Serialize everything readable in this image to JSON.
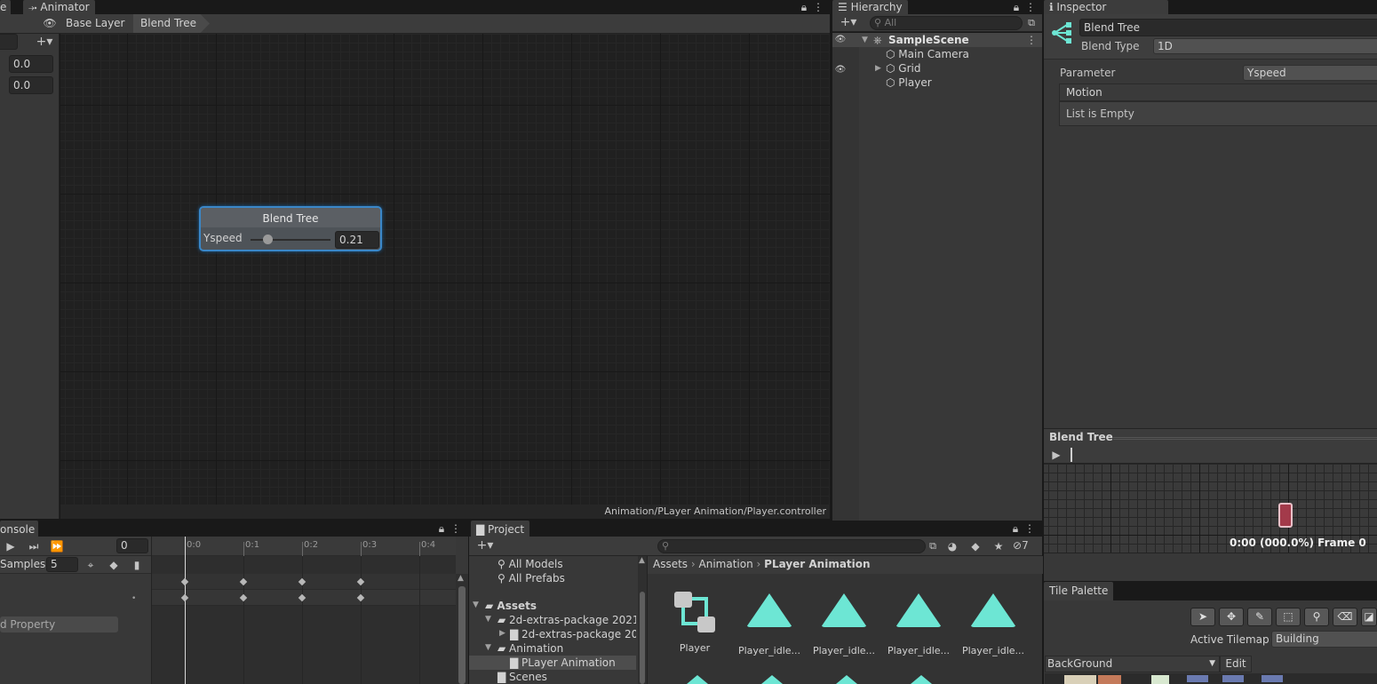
{
  "animator": {
    "tab_label": "Animator",
    "breadcrumb": [
      "Base Layer",
      "Blend Tree"
    ],
    "param_values": [
      "0.0",
      "0.0"
    ],
    "node": {
      "title": "Blend Tree",
      "param": "Yspeed",
      "value": "0.21",
      "slider_fraction": 0.21
    },
    "footer_path": "Animation/PLayer Animation/Player.controller"
  },
  "hierarchy": {
    "tab_label": "Hierarchy",
    "search_placeholder": "All",
    "scene": "SampleScene",
    "items": [
      "Main Camera",
      "Grid",
      "Player"
    ]
  },
  "inspector": {
    "tab_label": "Inspector",
    "object_name": "Blend Tree",
    "blend_type_label": "Blend Type",
    "blend_type_value": "1D",
    "parameter_label": "Parameter",
    "parameter_value": "Yspeed",
    "motion_label": "Motion",
    "list_empty": "List is Empty",
    "preview_title": "Blend Tree",
    "preview_time": "0:00 (000.0%) Frame 0"
  },
  "console": {
    "tab_label": "onsole",
    "frame_value": "0",
    "samples_label": "Samples",
    "samples_value": "5",
    "ticks": [
      "0:0",
      "0:1",
      "0:2",
      "0:3",
      "0:4"
    ],
    "add_property": "d Property"
  },
  "project": {
    "tab_label": "Project",
    "hidden_count": "7",
    "tree": [
      "All Models",
      "All Prefabs",
      "Assets",
      "2d-extras-package 2021",
      "2d-extras-package 20",
      "Animation",
      "PLayer Animation",
      "Scenes"
    ],
    "breadcrumb": [
      "Assets",
      "Animation",
      "PLayer Animation"
    ],
    "assets": [
      "Player",
      "Player_idle...",
      "Player_idle...",
      "Player_idle...",
      "Player_idle..."
    ]
  },
  "tile_palette": {
    "tab_label": "Tile Palette",
    "active_tilemap_label": "Active Tilemap",
    "active_tilemap_value": "Building",
    "palette_value": "BackGround",
    "edit_label": "Edit"
  },
  "colors": {
    "accent": "#6de6d4",
    "selection": "#2c5d87",
    "panel": "#383838",
    "grid": "#202020"
  }
}
